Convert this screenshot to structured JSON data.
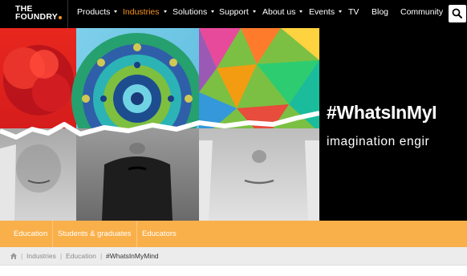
{
  "logo": {
    "line1": "THE",
    "line2": "FOUNDRY"
  },
  "nav": {
    "items": [
      {
        "label": "Products",
        "dropdown": true
      },
      {
        "label": "Industries",
        "dropdown": true,
        "active": true
      },
      {
        "label": "Solutions",
        "dropdown": true
      },
      {
        "label": "Support",
        "dropdown": true
      },
      {
        "label": "About us",
        "dropdown": true
      },
      {
        "label": "Events",
        "dropdown": true
      },
      {
        "label": "TV",
        "dropdown": false
      },
      {
        "label": "Blog",
        "dropdown": false
      },
      {
        "label": "Community",
        "dropdown": false
      }
    ],
    "search_icon": "search-icon"
  },
  "hero": {
    "title": "#WhatsInMyI",
    "subtitle": "imagination engir"
  },
  "subnav": {
    "items": [
      "Education",
      "Students & graduates",
      "Educators"
    ]
  },
  "breadcrumb": {
    "home_icon": "home-icon",
    "items": [
      "Industries",
      "Education"
    ],
    "current": "#WhatsInMyMind"
  },
  "colors": {
    "accent": "#f7941d",
    "subnav_bg": "#f9b04a",
    "nav_bg": "#000000"
  }
}
